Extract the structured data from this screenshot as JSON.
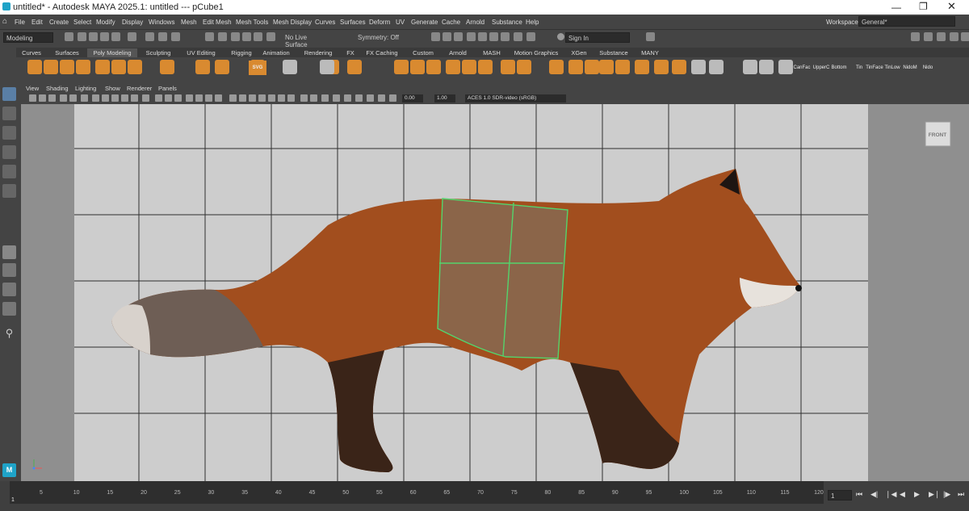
{
  "window": {
    "title": "untitled* - Autodesk MAYA 2025.1: untitled   ---   pCube1"
  },
  "menu": [
    "File",
    "Edit",
    "Create",
    "Select",
    "Modify",
    "Display",
    "Windows",
    "Mesh",
    "Edit Mesh",
    "Mesh Tools",
    "Mesh Display",
    "Curves",
    "Surfaces",
    "Deform",
    "UV",
    "Generate",
    "Cache",
    "Arnold",
    "Substance",
    "Help"
  ],
  "workspace": {
    "label": "Workspace:",
    "value": "General*"
  },
  "status": {
    "mode": "Modeling",
    "live_surface": "No Live Surface",
    "symmetry": "Symmetry: Off",
    "sign_in": "Sign In"
  },
  "shelf_tabs": [
    "Curves",
    "Surfaces",
    "Poly Modeling",
    "Sculpting",
    "UV Editing",
    "Rigging",
    "Animation",
    "Rendering",
    "FX",
    "FX Caching",
    "Custom",
    "Arnold",
    "MASH",
    "Motion Graphics",
    "XGen",
    "Substance",
    "MANY"
  ],
  "shelf_active": "Poly Modeling",
  "shelf_text_icons": [
    "SVG",
    "CanFac",
    "UpperC",
    "Bottom",
    "Tin",
    "TinFace",
    "TinLow",
    "NidoM",
    "Nido"
  ],
  "panel_menu": [
    "View",
    "Shading",
    "Lighting",
    "Show",
    "Renderer",
    "Panels"
  ],
  "panel_fields": {
    "exposure": "0.00",
    "gamma": "1.00",
    "colorspace": "ACES 1.0 SDR-video (sRGB)"
  },
  "viewport": {
    "camera_label": "FRONT"
  },
  "timeline": {
    "ticks": [
      "5",
      "10",
      "15",
      "20",
      "25",
      "30",
      "35",
      "40",
      "45",
      "50",
      "55",
      "60",
      "65",
      "70",
      "75",
      "80",
      "85",
      "90",
      "95",
      "100",
      "105",
      "110",
      "115",
      "120"
    ],
    "start": "1",
    "current": "1"
  },
  "colors": {
    "accent": "#5bc8e8",
    "wire": "#54d46c",
    "maya_blue": "#1fa3c8",
    "shelf_orange": "#d98a30"
  }
}
